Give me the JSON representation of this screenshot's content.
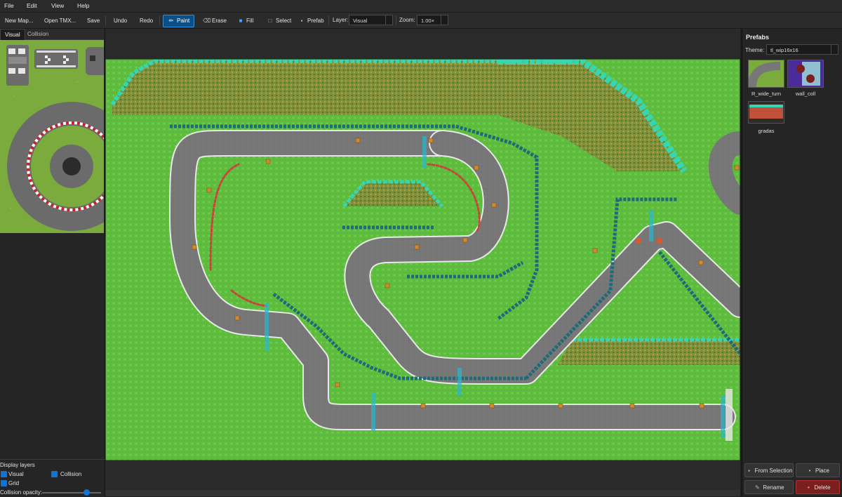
{
  "menu": {
    "file": "File",
    "edit": "Edit",
    "view": "View",
    "help": "Help"
  },
  "toolbar": {
    "new_map": "New Map...",
    "open_tmx": "Open TMX...",
    "save": "Save",
    "undo": "Undo",
    "redo": "Redo",
    "paint": "Paint",
    "erase": "Erase",
    "fill": "Fill",
    "select": "Select",
    "prefab": "Prefab",
    "layer_label": "Layer:",
    "layer_value": "Visual",
    "zoom_label": "Zoom:",
    "zoom_value": "1.00×"
  },
  "left_panel": {
    "tabs": [
      {
        "label": "Visual",
        "active": true
      },
      {
        "label": "Collision",
        "active": false
      }
    ],
    "display_layers_title": "Display layers",
    "layers": [
      {
        "label": "Visual",
        "checked": true
      },
      {
        "label": "Collision",
        "checked": true
      },
      {
        "label": "Grid",
        "checked": true
      }
    ],
    "collision_opacity_label": "Collision opacity:",
    "collision_opacity": 0.75
  },
  "right_panel": {
    "title": "Prefabs",
    "theme_label": "Theme:",
    "theme_value": "tl_wip16x16",
    "prefabs": [
      {
        "name": "R_wide_turn"
      },
      {
        "name": "wall_coll"
      },
      {
        "name": "gradas"
      }
    ],
    "buttons": {
      "from_selection": "From Selection",
      "place": "Place",
      "rename": "Rename",
      "delete": "Delete"
    }
  },
  "colors": {
    "grass": "#5fbf3f",
    "track": "#7a7a7a",
    "wall": "#1f6a7a",
    "water": "#35d6b0",
    "accent": "#0b4f86",
    "danger": "#7a1e1e"
  },
  "icons": [
    "paint-brush-icon",
    "eraser-icon",
    "fill-bucket-icon",
    "select-icon",
    "prefab-icon",
    "add-icon",
    "rename-icon",
    "delete-icon"
  ]
}
